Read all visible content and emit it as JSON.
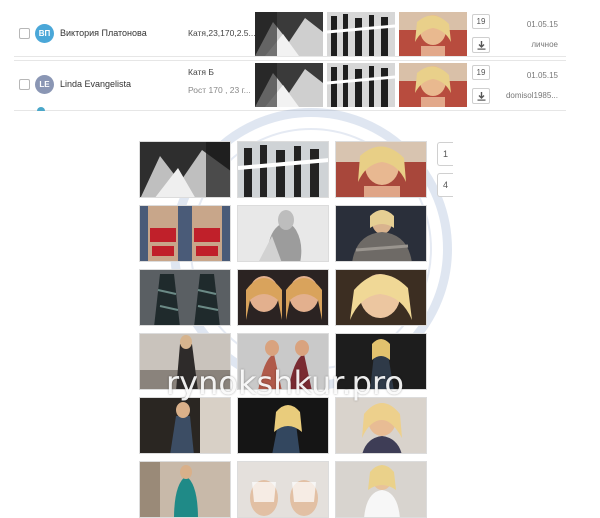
{
  "table": {
    "rows": [
      {
        "avatar_initials": "ВП",
        "avatar_color": "#4aa7d8",
        "name": "Виктория Платонова",
        "info_line1": "Катя,23,170,2.5...",
        "info_line2": "",
        "count": "19",
        "date": "01.05.15",
        "note": "личное"
      },
      {
        "avatar_initials": "LE",
        "avatar_color": "#8a96b4",
        "name": "Linda Evangelista",
        "info_line1": "Катя Б",
        "info_line2": "Рост 170 , 23 г...",
        "count": "19",
        "date": "01.05.15",
        "note": "domisol1985..."
      }
    ]
  },
  "gallery": {
    "side_buttons": [
      "1",
      "4"
    ]
  },
  "watermark": {
    "text": "rynokshkur.pro"
  }
}
